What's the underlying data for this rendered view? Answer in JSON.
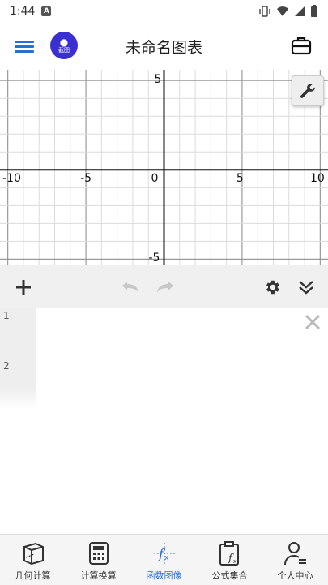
{
  "status": {
    "time": "1:44",
    "sim_icon": "A"
  },
  "app": {
    "title": "未命名图表",
    "logo_label": "截图"
  },
  "graph": {
    "x_labels": [
      "-10",
      "-5",
      "0",
      "5",
      "10"
    ],
    "y_labels": [
      "5",
      "-5"
    ],
    "x_range": [
      -10.5,
      10.5
    ],
    "y_range": [
      -5.3,
      5.6
    ]
  },
  "list": {
    "rows": [
      {
        "index": "1"
      },
      {
        "index": "2"
      }
    ]
  },
  "nav": {
    "items": [
      {
        "label": "几何计算",
        "icon": "cube-icon"
      },
      {
        "label": "计算换算",
        "icon": "calculator-icon"
      },
      {
        "label": "函数图像",
        "icon": "function-icon"
      },
      {
        "label": "公式集合",
        "icon": "clipboard-formula-icon"
      },
      {
        "label": "个人中心",
        "icon": "person-icon"
      }
    ],
    "active_color": "#2a6fd6"
  }
}
